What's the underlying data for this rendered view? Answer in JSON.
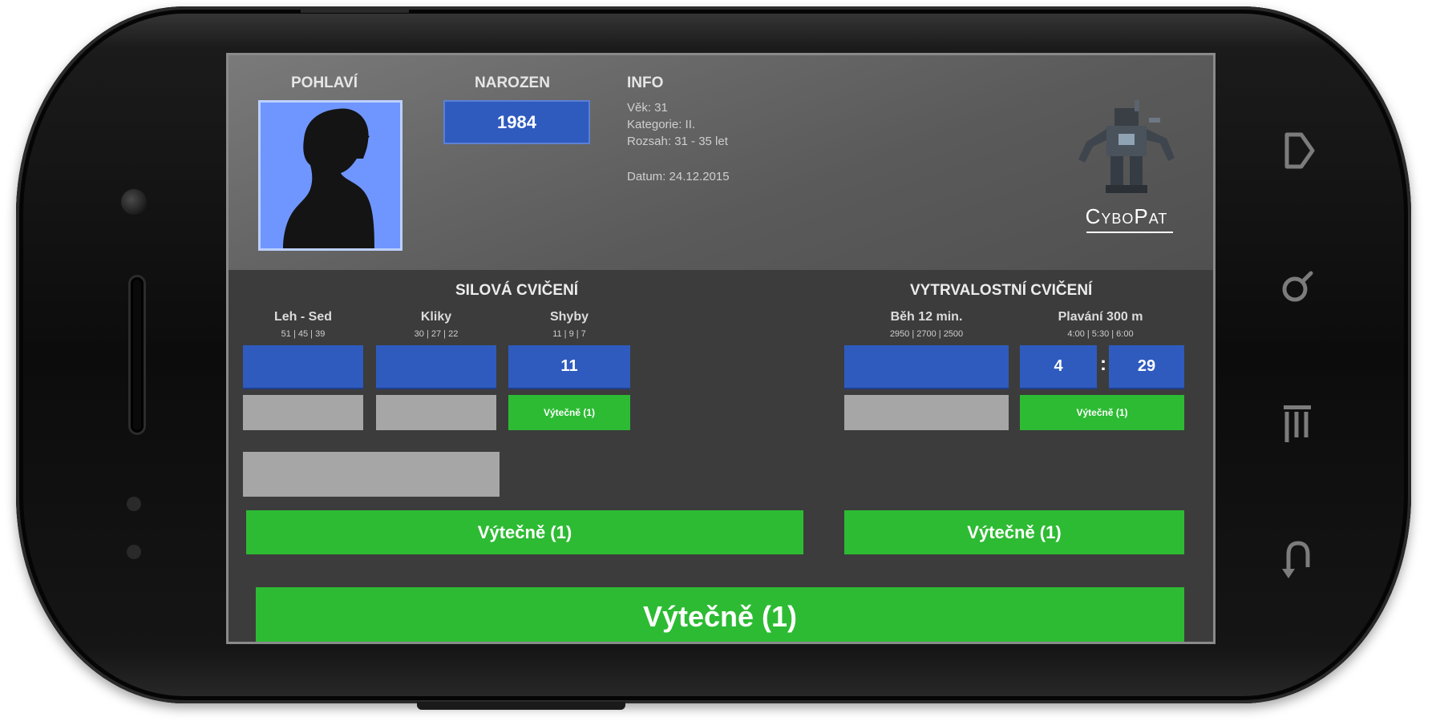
{
  "header": {
    "gender_label": "POHLAVÍ",
    "born_label": "NAROZEN",
    "born_value": "1984",
    "info_label": "INFO",
    "info_lines": [
      "Věk: 31",
      "Kategorie: II.",
      "Rozsah: 31 - 35 let"
    ],
    "date_line": "Datum: 24.12.2015",
    "logo_text": "CyboPat"
  },
  "strength": {
    "title": "SILOVÁ CVIČENÍ",
    "columns": [
      {
        "label": "Leh - Sed",
        "sub": "51 | 45 | 39",
        "value": ""
      },
      {
        "label": "Kliky",
        "sub": "30 | 27 | 22",
        "value": ""
      },
      {
        "label": "Shyby",
        "sub": "11 | 9 | 7",
        "value": "11",
        "result": "Výtečně (1)"
      }
    ],
    "total": "Výtečně (1)"
  },
  "endurance": {
    "title": "VYTRVALOSTNÍ CVIČENÍ",
    "columns": [
      {
        "label": "Běh 12 min.",
        "sub": "2950 | 2700 | 2500",
        "value": ""
      },
      {
        "label": "Plavání 300 m",
        "sub": "4:00 | 5:30 | 6:00",
        "minutes": "4",
        "seconds": "29",
        "result": "Výtečně (1)"
      }
    ],
    "total": "Výtečně (1)"
  },
  "overall": "Výtečně (1)",
  "colors": {
    "input_blue": "#2f5bbf",
    "result_green": "#2dbb33",
    "empty_grey": "#a6a6a6",
    "avatar_blue": "#6f96ff"
  },
  "icons": {
    "nav": [
      "home-icon",
      "search-icon",
      "menu-icon",
      "back-icon"
    ]
  }
}
